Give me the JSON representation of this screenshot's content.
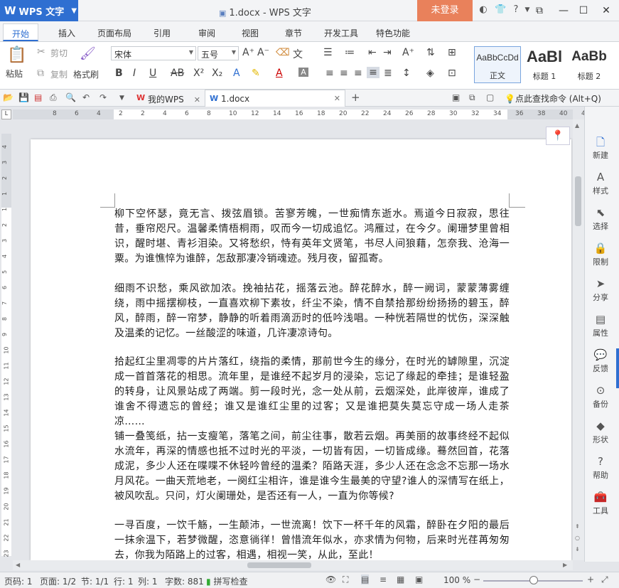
{
  "app": {
    "name": "WPS 文字",
    "window_title": "1.docx - WPS 文字",
    "login": "未登录"
  },
  "menu_tabs": [
    "开始",
    "插入",
    "页面布局",
    "引用",
    "审阅",
    "视图",
    "章节",
    "开发工具",
    "特色功能"
  ],
  "ribbon": {
    "paste": "粘贴",
    "cut": "剪切",
    "copy": "复制",
    "format_painter": "格式刷",
    "font_name": "宋体",
    "font_size": "五号",
    "styles": [
      {
        "sample": "AaBbCcDd",
        "label": "正文"
      },
      {
        "sample": "AaBl",
        "label": "标题 1"
      },
      {
        "sample": "AaBb",
        "label": "标题 2"
      }
    ]
  },
  "doc_tabs": [
    {
      "label": "我的WPS",
      "icon": "W"
    },
    {
      "label": "1.docx",
      "icon": "W"
    }
  ],
  "search_command": "点此查找命令 (Alt+Q)",
  "ruler": {
    "h_ticks": [
      "8",
      "6",
      "4",
      "2",
      "2",
      "4",
      "6",
      "8",
      "10",
      "12",
      "14",
      "16",
      "18",
      "20",
      "22",
      "24",
      "26",
      "28",
      "30",
      "32",
      "34",
      "36",
      "38",
      "40",
      "42",
      "4"
    ],
    "v_ticks": [
      "4",
      "3",
      "2",
      "1",
      "1",
      "2",
      "3",
      "4",
      "5",
      "6",
      "7",
      "8",
      "9",
      "10",
      "11",
      "12",
      "13",
      "14",
      "15",
      "16",
      "17",
      "18",
      "19",
      "20",
      "21",
      "22",
      "23"
    ]
  },
  "document": {
    "paragraphs": [
      "柳下空怀瑟，竟无言、拨弦眉锁。苦寥芳魄，一世痴情东逝水。焉道今日寂寂，思往昔，垂帘咫尺。温馨柔情梧桐雨，叹而今一切成追忆。鸿雁过，在今夕。阑珊梦里曾相识，醒时堪、青衫泪染。又将愁织，恃有英年文贤笔，书尽人间狼藉，怎奈我、沧海一粟。为谁憔悴为谁醉，怎敌那凄冷销魂迹。残月夜，留孤寄。",
      "细雨不识愁，乘风欲加浓。挽袖拈花，摇落云池。醉花醉水，醉一阙词，蒙蒙薄雾缠绕，雨中摇摆柳枝，一直喜欢柳下素妆，纤尘不染，情不自禁拾那纷纷扬扬的碧玉，醉风，醉雨，醉一帘梦，静静的听着雨滴沥时的低吟浅唱。一种恍若隔世的忧伤，深深触及温柔的记忆。一丝酸涩的味道，几许凄凉诗句。",
      "拾起红尘里凋零的片片落红，绕指的柔情，那前世今生的缘分，在时光的罅隙里，沉淀成一首首落花的相思。流年里，是谁经不起岁月的浸染，忘记了缘起的牵挂；是谁轻盈的转身，让风景站成了两端。剪一段时光，念一处从前，云烟深处，此岸彼岸，谁成了谁舍不得遗忘的曾经；谁又是谁红尘里的过客；又是谁把莫失莫忘守成一场人走茶凉……",
      "铺一叠笺纸，拈一支瘦笔，落笔之间，前尘往事，散若云烟。再美丽的故事终经不起似水流年，再深的情感也抵不过时光的平淡，一切皆有因，一切皆成缘。蓦然回首，花落成泥，多少人还在喋喋不休轻吟曾经的温柔？陌路天涯，多少人还在念念不忘那一场水月风花。一曲天荒地老，一阕红尘相许，谁是谁今生最美的守望?谁人的深情写在纸上，被风吹乱。只问，灯火阑珊处，是否还有一人，一直为你等候?",
      "一寻百度，一饮千觞，一生颠沛，一世流离！饮下一杯千年的风霜，醉卧在夕阳的最后一抹余温下，若梦微醒，恣意徜徉！曾惜流年似水，亦求情为何物，后来时光荏苒匆匆去，你我为陌路上的过客，相遇，相视一笑，从此，至此！"
    ]
  },
  "side_panel": [
    "新建",
    "样式",
    "选择",
    "限制",
    "分享",
    "属性",
    "反馈",
    "备份",
    "形状",
    "帮助",
    "工具"
  ],
  "status": {
    "page_num": "页码: 1",
    "page": "页面: 1/2",
    "section": "节: 1/1",
    "row": "行: 1",
    "col": "列: 1",
    "words": "字数: 881",
    "spell": "拼写检查",
    "zoom": "100 %"
  }
}
